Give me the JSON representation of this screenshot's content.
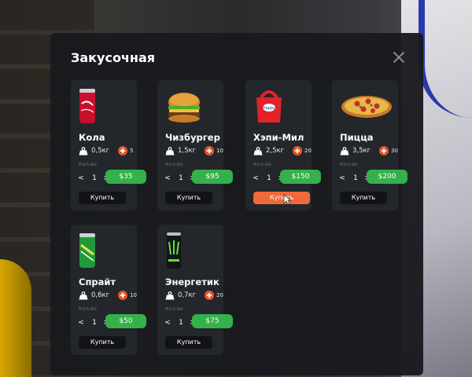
{
  "shop": {
    "title": "Закусочная",
    "quantity_label": "Кол-во",
    "buy_label": "Купить",
    "items": [
      {
        "name": "Кола",
        "weight": "0,5кг",
        "satiety": "5",
        "quantity": "1",
        "price": "$35",
        "icon": "cola-can-icon"
      },
      {
        "name": "Чизбургер",
        "weight": "1,5кг",
        "satiety": "10",
        "quantity": "1",
        "price": "$95",
        "icon": "cheeseburger-icon"
      },
      {
        "name": "Хэпи-Мил",
        "weight": "2,5кг",
        "satiety": "20",
        "quantity": "1",
        "price": "$150",
        "icon": "happy-meal-icon"
      },
      {
        "name": "Пицца",
        "weight": "3,5кг",
        "satiety": "30",
        "quantity": "1",
        "price": "$200",
        "icon": "pizza-icon"
      },
      {
        "name": "Спрайт",
        "weight": "0,6кг",
        "satiety": "10",
        "quantity": "1",
        "price": "$50",
        "icon": "sprite-can-icon"
      },
      {
        "name": "Энергетик",
        "weight": "0,7кг",
        "satiety": "20",
        "quantity": "1",
        "price": "$75",
        "icon": "energy-drink-icon"
      }
    ]
  },
  "colors": {
    "panel_bg": "#181a1e",
    "card_bg": "#23262b",
    "price_green": "#34b14a",
    "buy_active_orange": "#f0693a",
    "satiety_orange": "#e8572b"
  }
}
